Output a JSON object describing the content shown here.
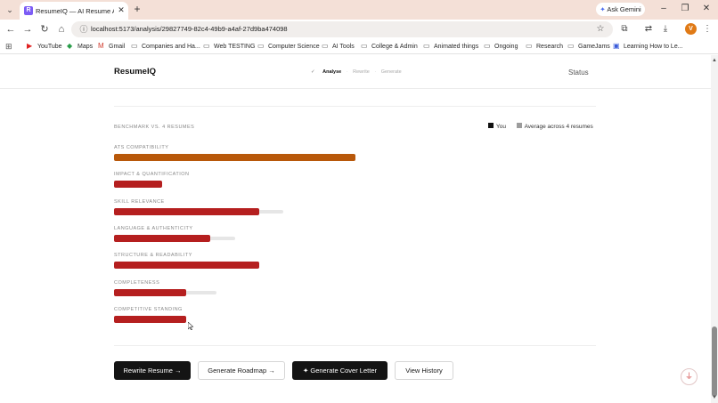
{
  "browser": {
    "tab_title": "ResumeIQ — AI Resume Analyz",
    "favicon_letter": "R",
    "url": "localhost:5173/analysis/29827749-82c4-49b9-a4af-27d9ba474098",
    "ask_gemini": "Ask Gemini",
    "profile_initial": "V",
    "bookmarks": [
      {
        "label": "YouTube",
        "icon": "youtube-icon"
      },
      {
        "label": "Maps",
        "icon": "maps-icon"
      },
      {
        "label": "Gmail",
        "icon": "gmail-icon"
      },
      {
        "label": "Companies and Ha...",
        "icon": "folder-icon"
      },
      {
        "label": "Web TESTING",
        "icon": "folder-icon"
      },
      {
        "label": "Computer Science",
        "icon": "folder-icon"
      },
      {
        "label": "AI Tools",
        "icon": "folder-icon"
      },
      {
        "label": "College & Admin",
        "icon": "folder-icon"
      },
      {
        "label": "Animated things",
        "icon": "folder-icon"
      },
      {
        "label": "Ongoing",
        "icon": "folder-icon"
      },
      {
        "label": "Research",
        "icon": "folder-icon"
      },
      {
        "label": "GameJams",
        "icon": "folder-icon"
      },
      {
        "label": "Learning How to Le...",
        "icon": "bookmark-icon"
      }
    ]
  },
  "app": {
    "logo": "ResumeIQ",
    "steps": {
      "done": "✓",
      "analyse": "Analyse",
      "rewrite": "Rewrite",
      "generate": "Generate",
      "separator": "·"
    },
    "status": "Status"
  },
  "benchmark": {
    "title": "BENCHMARK VS. 4 RESUMES",
    "legend_you": "You",
    "legend_avg": "Average across 4 resumes",
    "colors": {
      "you_red": "#b51f1f",
      "you_orange": "#b8580a",
      "average": "#e6e6e6",
      "legend_you": "#111111",
      "legend_avg": "#9c9c9c"
    },
    "metrics": [
      {
        "label": "ATS COMPATIBILITY",
        "you": 1.0,
        "average": 0.93,
        "color": "#b8580a"
      },
      {
        "label": "IMPACT & QUANTIFICATION",
        "you": 0.2,
        "average": 0.2,
        "color": "#b51f1f"
      },
      {
        "label": "SKILL RELEVANCE",
        "you": 0.6,
        "average": 0.7,
        "color": "#b51f1f"
      },
      {
        "label": "LANGUAGE & AUTHENTICITY",
        "you": 0.4,
        "average": 0.5,
        "color": "#b51f1f"
      },
      {
        "label": "STRUCTURE & READABILITY",
        "you": 0.6,
        "average": 0.55,
        "color": "#b51f1f"
      },
      {
        "label": "COMPLETENESS",
        "you": 0.3,
        "average": 0.425,
        "color": "#b51f1f"
      },
      {
        "label": "COMPETITIVE STANDING",
        "you": 0.3,
        "average": 0.25,
        "color": "#b51f1f"
      }
    ]
  },
  "actions": {
    "rewrite": "Rewrite Resume →",
    "roadmap": "Generate Roadmap →",
    "cover_letter": "✦ Generate Cover Letter",
    "history": "View History"
  }
}
